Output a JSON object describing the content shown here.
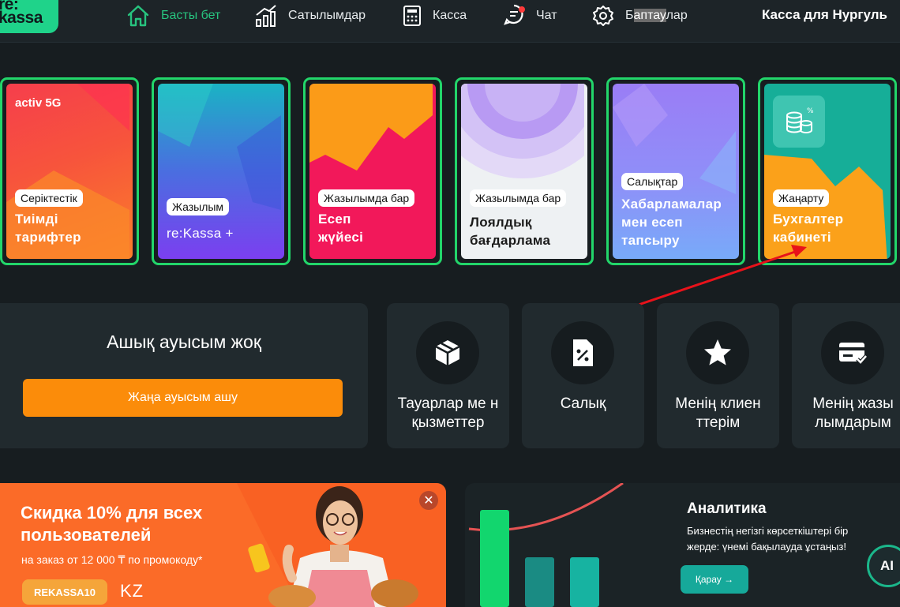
{
  "app": {
    "logo_line1": "re:",
    "logo_line2": "kassa",
    "account_name": "Касса для Нургуль"
  },
  "nav": {
    "items": [
      {
        "label": "Басты бет",
        "icon": "home-icon"
      },
      {
        "label": "Сатылымдар",
        "icon": "chart-icon"
      },
      {
        "label": "Касса",
        "icon": "calculator-icon"
      },
      {
        "label": "Чат",
        "icon": "chat-icon"
      },
      {
        "label_pre": "Б",
        "label_sel": "аптау",
        "label_post": "лар",
        "icon": "gear-icon"
      }
    ]
  },
  "cards": [
    {
      "badge": "Серіктестік",
      "title": "Тиімді тарифтер",
      "brand": "activ 5G"
    },
    {
      "badge": "Жазылым",
      "title": "re:Kassa +"
    },
    {
      "badge": "Жазылымда бар",
      "title": "Есеп жүйесі"
    },
    {
      "badge": "Жазылымда бар",
      "title": "Лоялдық бағдарлама"
    },
    {
      "badge": "Салықтар",
      "title": "Хабарламалар мен есеп тапсыру"
    },
    {
      "badge": "Жаңарту",
      "title": "Бухгалтер кабинеті"
    }
  ],
  "shift": {
    "title": "Ашық ауысым жоқ",
    "button": "Жаңа ауысым ашу"
  },
  "tiles": [
    {
      "label": "Тауарлар ме н қызметтер",
      "icon": "box-icon"
    },
    {
      "label": "Салық",
      "icon": "tax-document-icon"
    },
    {
      "label": "Менің клиен ттерім",
      "icon": "star-icon"
    },
    {
      "label": "Менің жазы лымдарым",
      "icon": "card-check-icon"
    }
  ],
  "promo": {
    "title": "Скидка 10% для всех пользователей",
    "subtitle": "на заказ от 12 000 ₸ по промокоду*",
    "code": "REKASSA10",
    "kz": "KZ",
    "close": "✕"
  },
  "analytics": {
    "title": "Аналитика",
    "description": "Бизнестің негізгі көрсеткіштері бір жерде: үнемі бақылауда ұстаңыз!",
    "button": "Қарау →"
  },
  "ai_button": "AI",
  "colors": {
    "accent_green": "#22d66a",
    "orange": "#fb8c0a",
    "annotation_arrow": "#e8121a"
  }
}
